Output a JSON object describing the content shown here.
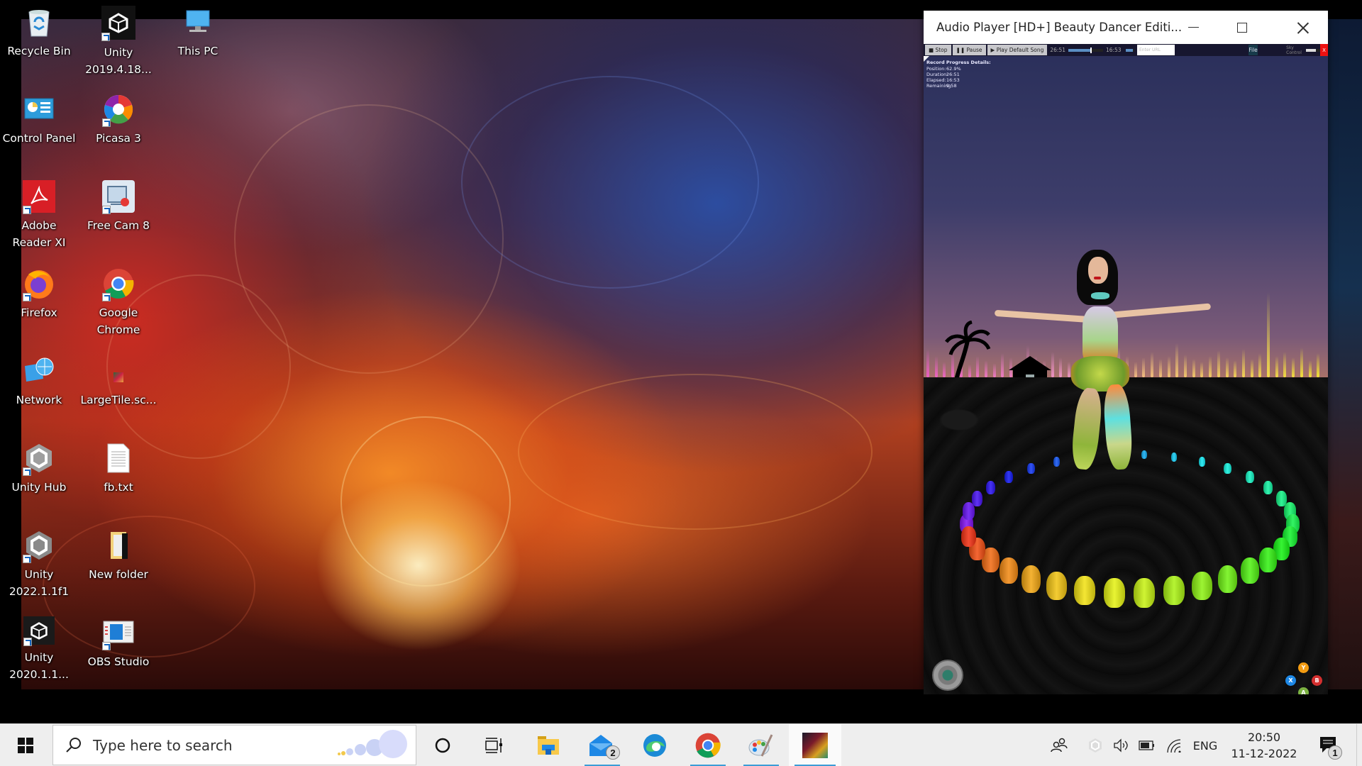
{
  "desktop": {
    "icons": [
      {
        "label": "Recycle Bin",
        "icon": "recycle-bin-icon",
        "shortcut": false
      },
      {
        "label": "Unity 2019.4.18...",
        "icon": "unity-icon",
        "shortcut": true
      },
      {
        "label": "This PC",
        "icon": "this-pc-icon",
        "shortcut": false
      },
      {
        "label": "Control Panel",
        "icon": "control-panel-icon",
        "shortcut": false
      },
      {
        "label": "Picasa 3",
        "icon": "picasa-icon",
        "shortcut": true
      },
      {
        "label": "Adobe Reader XI",
        "icon": "adobe-reader-icon",
        "shortcut": true
      },
      {
        "label": "Free Cam 8",
        "icon": "free-cam-icon",
        "shortcut": true
      },
      {
        "label": "Firefox",
        "icon": "firefox-icon",
        "shortcut": true
      },
      {
        "label": "Google Chrome",
        "icon": "chrome-icon",
        "shortcut": true
      },
      {
        "label": "Network",
        "icon": "network-icon",
        "shortcut": false
      },
      {
        "label": "LargeTile.sc...",
        "icon": "image-file-icon",
        "shortcut": false
      },
      {
        "label": "Unity Hub",
        "icon": "unity-hub-icon",
        "shortcut": true
      },
      {
        "label": "fb.txt",
        "icon": "text-file-icon",
        "shortcut": false
      },
      {
        "label": "Unity 2022.1.1f1",
        "icon": "unity-hub-icon",
        "shortcut": true
      },
      {
        "label": "New folder",
        "icon": "folder-icon",
        "shortcut": false
      },
      {
        "label": "Unity 2020.1.1...",
        "icon": "unity-icon",
        "shortcut": true
      },
      {
        "label": "OBS Studio",
        "icon": "obs-studio-icon",
        "shortcut": true
      }
    ]
  },
  "player": {
    "title": "Audio Player [HD+] Beauty Dancer Editi...",
    "toolbar": {
      "stop_label": "■ Stop",
      "pause_label": "❚❚ Pause",
      "play_default_label": "▶ Play Default Song",
      "duration_text": "26:51",
      "elapsed_text": "16:53",
      "seek_progress_percent": 62.9,
      "volume_percent": 80,
      "url_placeholder": "Enter URL",
      "file_label": "File",
      "sky_control_label": "Sky Control",
      "sky_control_percent": 45,
      "close_label": "X"
    },
    "progress_details": {
      "header": "Record Progress Details:",
      "rows": [
        {
          "key": "Position:",
          "value": "62.9%"
        },
        {
          "key": "Duration:",
          "value": "26:51"
        },
        {
          "key": "Elapsed:",
          "value": "16:53"
        },
        {
          "key": "Remaining:",
          "value": "9:58"
        }
      ]
    },
    "gamepad_buttons": [
      {
        "label": "Y",
        "color": "#f39c12"
      },
      {
        "label": "X",
        "color": "#1e88e5"
      },
      {
        "label": "B",
        "color": "#d32f2f"
      },
      {
        "label": "A",
        "color": "#7cb342"
      }
    ]
  },
  "taskbar": {
    "search_placeholder": "Type here to search",
    "apps": [
      {
        "name": "cortana",
        "icon": "cortana-icon",
        "active": false
      },
      {
        "name": "task-view",
        "icon": "task-view-icon",
        "active": false
      },
      {
        "name": "file-explorer",
        "icon": "file-explorer-icon",
        "active": false
      },
      {
        "name": "mail",
        "icon": "mail-icon",
        "active": true,
        "badge": "2"
      },
      {
        "name": "edge",
        "icon": "edge-icon",
        "active": false
      },
      {
        "name": "chrome",
        "icon": "chrome-icon",
        "active": true
      },
      {
        "name": "paint",
        "icon": "paint-icon",
        "active": true
      },
      {
        "name": "audio-player",
        "icon": "audio-player-app-icon",
        "active": true
      }
    ],
    "tray": {
      "language": "ENG",
      "time": "20:50",
      "date": "11-12-2022",
      "notifications_badge": "1"
    }
  },
  "colors": {
    "accent": "#3b9cd6",
    "seek_fill": "#5b8fc4",
    "close_red": "#e11111"
  }
}
